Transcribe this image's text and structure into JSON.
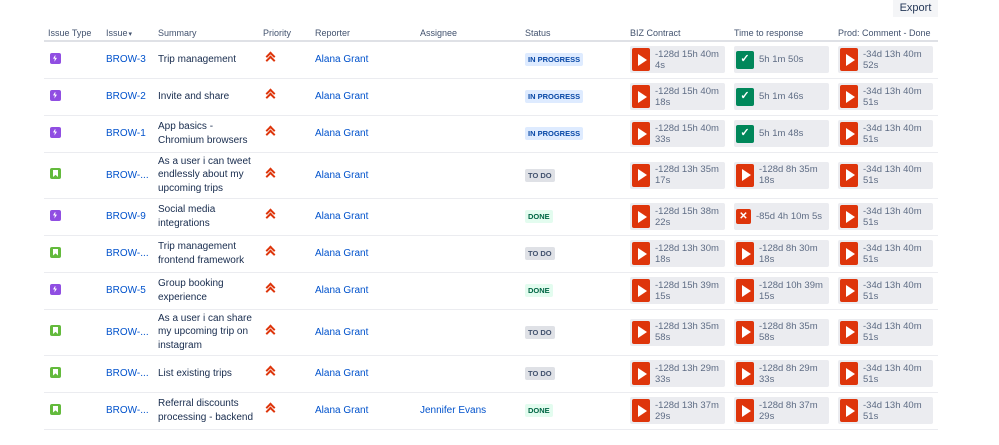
{
  "toolbar": {
    "export_label": "Export"
  },
  "columns": {
    "issue_type": "Issue Type",
    "issue": "Issue",
    "issue_sort_indicator": "▾",
    "summary": "Summary",
    "priority": "Priority",
    "reporter": "Reporter",
    "assignee": "Assignee",
    "status": "Status",
    "biz_contract": "BIZ Contract",
    "time_to_response": "Time to response",
    "prod_comment_done": "Prod: Comment - Done"
  },
  "icons": {
    "epic": "lightning-icon",
    "story": "bookmark-icon",
    "priority_highest": "double-chevron-up-icon",
    "sla_breached": "play-icon",
    "sla_met": "check-icon",
    "sla_failed": "cross-icon"
  },
  "colors": {
    "link": "#0052cc",
    "epic": "#904ee2",
    "story": "#63ba3c",
    "sla_breached": "#de350b",
    "sla_met": "#00875a",
    "in_progress_bg": "#deebff",
    "done_bg": "#e3fcef",
    "todo_bg": "#dfe1e6"
  },
  "rows": [
    {
      "type": "epic",
      "key": "BROW-3",
      "summary": "Trip management",
      "priority": "highest",
      "reporter": "Alana Grant",
      "assignee": "",
      "status": "IN PROGRESS",
      "status_kind": "inprogress",
      "biz": {
        "kind": "breached",
        "text": "-128d 15h 40m 4s"
      },
      "response": {
        "kind": "met",
        "text": "5h 1m 50s"
      },
      "prod": {
        "kind": "breached",
        "text": "-34d 13h 40m 52s"
      }
    },
    {
      "type": "epic",
      "key": "BROW-2",
      "summary": "Invite and share",
      "priority": "highest",
      "reporter": "Alana Grant",
      "assignee": "",
      "status": "IN PROGRESS",
      "status_kind": "inprogress",
      "biz": {
        "kind": "breached",
        "text": "-128d 15h 40m 18s"
      },
      "response": {
        "kind": "met",
        "text": "5h 1m 46s"
      },
      "prod": {
        "kind": "breached",
        "text": "-34d 13h 40m 51s"
      }
    },
    {
      "type": "epic",
      "key": "BROW-1",
      "summary": "App basics - Chromium browsers",
      "priority": "highest",
      "reporter": "Alana Grant",
      "assignee": "",
      "status": "IN PROGRESS",
      "status_kind": "inprogress",
      "biz": {
        "kind": "breached",
        "text": "-128d 15h 40m 33s"
      },
      "response": {
        "kind": "met",
        "text": "5h 1m 48s"
      },
      "prod": {
        "kind": "breached",
        "text": "-34d 13h 40m 51s"
      }
    },
    {
      "type": "story",
      "key": "BROW-...",
      "summary": "As a user i can tweet endlessly about my upcoming trips",
      "priority": "highest",
      "reporter": "Alana Grant",
      "assignee": "",
      "status": "TO DO",
      "status_kind": "todo",
      "biz": {
        "kind": "breached",
        "text": "-128d 13h 35m 17s"
      },
      "response": {
        "kind": "breached",
        "text": "-128d 8h 35m 18s"
      },
      "prod": {
        "kind": "breached",
        "text": "-34d 13h 40m 51s"
      }
    },
    {
      "type": "epic",
      "key": "BROW-9",
      "summary": "Social media integrations",
      "priority": "highest",
      "reporter": "Alana Grant",
      "assignee": "",
      "status": "DONE",
      "status_kind": "done",
      "biz": {
        "kind": "breached",
        "text": "-128d 15h 38m 22s"
      },
      "response": {
        "kind": "failed",
        "text": "-85d 4h 10m 5s"
      },
      "prod": {
        "kind": "breached",
        "text": "-34d 13h 40m 51s"
      }
    },
    {
      "type": "story",
      "key": "BROW-...",
      "summary": "Trip management frontend framework",
      "priority": "highest",
      "reporter": "Alana Grant",
      "assignee": "",
      "status": "TO DO",
      "status_kind": "todo",
      "biz": {
        "kind": "breached",
        "text": "-128d 13h 30m 18s"
      },
      "response": {
        "kind": "breached",
        "text": "-128d 8h 30m 18s"
      },
      "prod": {
        "kind": "breached",
        "text": "-34d 13h 40m 51s"
      }
    },
    {
      "type": "epic",
      "key": "BROW-5",
      "summary": "Group booking experience",
      "priority": "highest",
      "reporter": "Alana Grant",
      "assignee": "",
      "status": "DONE",
      "status_kind": "done",
      "biz": {
        "kind": "breached",
        "text": "-128d 15h 39m 15s"
      },
      "response": {
        "kind": "breached",
        "text": "-128d 10h 39m 15s"
      },
      "prod": {
        "kind": "breached",
        "text": "-34d 13h 40m 51s"
      }
    },
    {
      "type": "story",
      "key": "BROW-...",
      "summary": "As a user i can share my upcoming trip on instagram",
      "priority": "highest",
      "reporter": "Alana Grant",
      "assignee": "",
      "status": "TO DO",
      "status_kind": "todo",
      "biz": {
        "kind": "breached",
        "text": "-128d 13h 35m 58s"
      },
      "response": {
        "kind": "breached",
        "text": "-128d 8h 35m 58s"
      },
      "prod": {
        "kind": "breached",
        "text": "-34d 13h 40m 51s"
      }
    },
    {
      "type": "story",
      "key": "BROW-...",
      "summary": "List existing trips",
      "priority": "highest",
      "reporter": "Alana Grant",
      "assignee": "",
      "status": "TO DO",
      "status_kind": "todo",
      "biz": {
        "kind": "breached",
        "text": "-128d 13h 29m 33s"
      },
      "response": {
        "kind": "breached",
        "text": "-128d 8h 29m 33s"
      },
      "prod": {
        "kind": "breached",
        "text": "-34d 13h 40m 51s"
      }
    },
    {
      "type": "story",
      "key": "BROW-...",
      "summary": "Referral discounts processing - backend",
      "priority": "highest",
      "reporter": "Alana Grant",
      "assignee": "Jennifer Evans",
      "status": "DONE",
      "status_kind": "done",
      "biz": {
        "kind": "breached",
        "text": "-128d 13h 37m 29s"
      },
      "response": {
        "kind": "breached",
        "text": "-128d 8h 37m 29s"
      },
      "prod": {
        "kind": "breached",
        "text": "-34d 13h 40m 51s"
      }
    }
  ]
}
